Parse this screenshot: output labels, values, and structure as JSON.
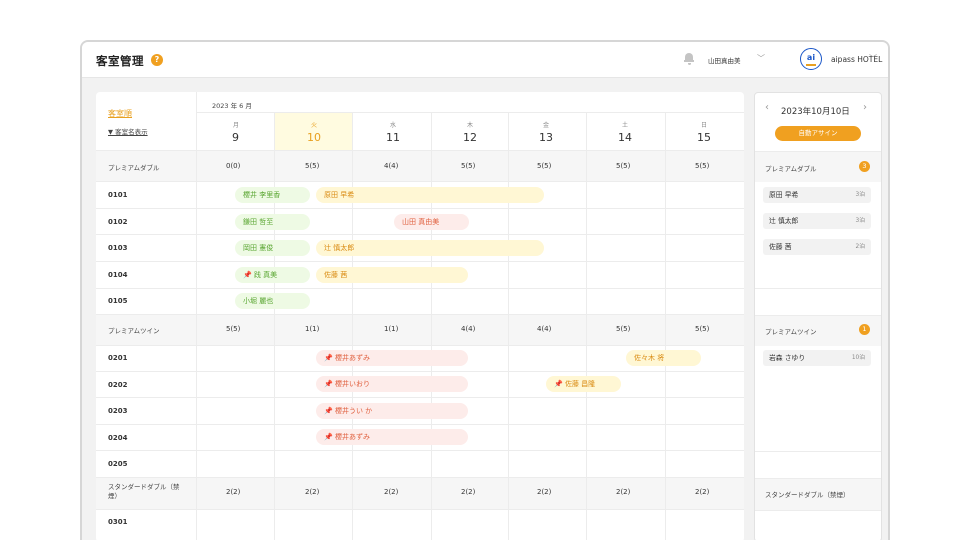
{
  "header": {
    "title": "客室管理",
    "help": "?",
    "user_name": "山田真由美",
    "hotel_name": "aipass HOTEL",
    "logo_text": "ai",
    "icons": {
      "notification": "bell-icon",
      "dropdown": "chevron-down-icon"
    }
  },
  "calendar": {
    "room_order_label": "客室順",
    "room_name_toggle": "▼ 客室名表示",
    "month_label": "2023 年 6 月",
    "days": [
      {
        "weekday": "月",
        "date": "9"
      },
      {
        "weekday": "火",
        "date": "10"
      },
      {
        "weekday": "水",
        "date": "11"
      },
      {
        "weekday": "木",
        "date": "12"
      },
      {
        "weekday": "金",
        "date": "13"
      },
      {
        "weekday": "土",
        "date": "14"
      },
      {
        "weekday": "日",
        "date": "15"
      }
    ],
    "room_types": [
      {
        "name": "プレミアムダブル",
        "counts": [
          "0(0)",
          "5(5)",
          "4(4)",
          "5(5)",
          "5(5)",
          "5(5)",
          "5(5)"
        ]
      },
      {
        "name": "プレミアムツイン",
        "counts": [
          "5(5)",
          "1(1)",
          "1(1)",
          "4(4)",
          "4(4)",
          "5(5)",
          "5(5)"
        ]
      },
      {
        "name": "スタンダードダブル（禁煙）",
        "counts": [
          "2(2)",
          "2(2)",
          "2(2)",
          "2(2)",
          "2(2)",
          "2(2)",
          "2(2)"
        ]
      }
    ],
    "rooms": [
      "0101",
      "0102",
      "0103",
      "0104",
      "0105",
      "0201",
      "0202",
      "0203",
      "0204",
      "0205",
      "0301"
    ],
    "reservations": [
      {
        "name": "櫻井 李里香"
      },
      {
        "name": "原田 早希"
      },
      {
        "name": "鎌田 哲至"
      },
      {
        "name": "山田 真由美"
      },
      {
        "name": "岡田 憲俊"
      },
      {
        "name": "辻 慎太郎"
      },
      {
        "name": "📌 践 真美"
      },
      {
        "name": "佐藤 茜"
      },
      {
        "name": "小堀 麗也"
      },
      {
        "name": "📌 櫻井あずみ"
      },
      {
        "name": "佐々木 将"
      },
      {
        "name": "📌 櫻井いおり"
      },
      {
        "name": "📌 佐藤 昌隆"
      },
      {
        "name": "📌 櫻井うい か"
      },
      {
        "name": "📌 櫻井あずみ"
      }
    ]
  },
  "assign_panel": {
    "date": "2023年10月10日",
    "auto_assign": "自動アサイン",
    "groups": [
      {
        "name": "プレミアムダブル",
        "count": "3",
        "guests": [
          {
            "name": "原田 早希",
            "nights": "3泊"
          },
          {
            "name": "辻 慎太郎",
            "nights": "3泊"
          },
          {
            "name": "佐藤 茜",
            "nights": "2泊"
          }
        ]
      },
      {
        "name": "プレミアムツイン",
        "count": "1",
        "guests": [
          {
            "name": "岩森 さゆり",
            "nights": "10泊"
          }
        ]
      },
      {
        "name": "スタンダードダブル（禁煙）",
        "count": "",
        "guests": []
      }
    ]
  },
  "colors": {
    "accent": "#f0a020",
    "today_bg": "#fffbe0",
    "green": "#5aa632",
    "yellow": "#d98a10",
    "pink": "#e0603f"
  }
}
